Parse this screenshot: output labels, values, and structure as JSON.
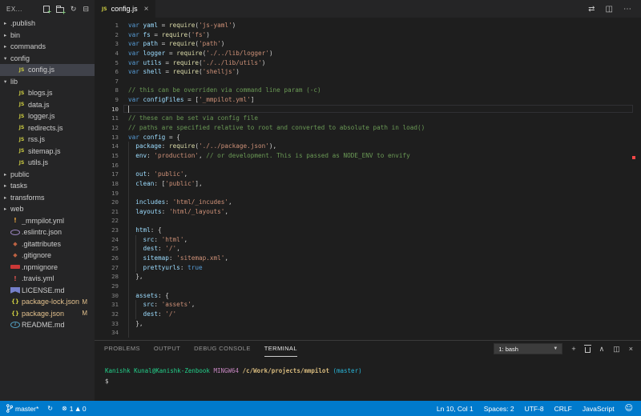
{
  "explorer": {
    "title": "EX...",
    "items": [
      {
        "label": ".publish",
        "kind": "folder",
        "depth": 0
      },
      {
        "label": "bin",
        "kind": "folder",
        "depth": 0
      },
      {
        "label": "commands",
        "kind": "folder",
        "depth": 0
      },
      {
        "label": "config",
        "kind": "folder-open",
        "depth": 0
      },
      {
        "label": "config.js",
        "kind": "js",
        "depth": 1,
        "selected": true
      },
      {
        "label": "lib",
        "kind": "folder-open",
        "depth": 0
      },
      {
        "label": "blogs.js",
        "kind": "js",
        "depth": 1
      },
      {
        "label": "data.js",
        "kind": "js",
        "depth": 1
      },
      {
        "label": "logger.js",
        "kind": "js",
        "depth": 1
      },
      {
        "label": "redirects.js",
        "kind": "js",
        "depth": 1
      },
      {
        "label": "rss.js",
        "kind": "js",
        "depth": 1
      },
      {
        "label": "sitemap.js",
        "kind": "js",
        "depth": 1
      },
      {
        "label": "utils.js",
        "kind": "js",
        "depth": 1
      },
      {
        "label": "public",
        "kind": "folder",
        "depth": 0
      },
      {
        "label": "tasks",
        "kind": "folder",
        "depth": 0
      },
      {
        "label": "transforms",
        "kind": "folder",
        "depth": 0
      },
      {
        "label": "web",
        "kind": "folder",
        "depth": 0
      },
      {
        "label": "_mmpilot.yml",
        "kind": "yml",
        "depth": 0
      },
      {
        "label": ".eslintrc.json",
        "kind": "eslint",
        "depth": 0
      },
      {
        "label": ".gitattributes",
        "kind": "git",
        "depth": 0
      },
      {
        "label": ".gitignore",
        "kind": "git",
        "depth": 0
      },
      {
        "label": ".npmignore",
        "kind": "npm",
        "depth": 0
      },
      {
        "label": ".travis.yml",
        "kind": "yml2",
        "depth": 0
      },
      {
        "label": "LICENSE.md",
        "kind": "license",
        "depth": 0
      },
      {
        "label": "package-lock.json",
        "kind": "json",
        "depth": 0,
        "badge": "M",
        "modified": true
      },
      {
        "label": "package.json",
        "kind": "json",
        "depth": 0,
        "badge": "M",
        "modified": true
      },
      {
        "label": "README.md",
        "kind": "info",
        "depth": 0
      }
    ]
  },
  "tabs": {
    "active_label": "config.js",
    "file_icon": "JS"
  },
  "editor": {
    "cursor_line": 10,
    "lines": [
      {
        "n": 1,
        "g": 0,
        "segs": [
          [
            "k",
            "var"
          ],
          [
            "p",
            " "
          ],
          [
            "v",
            "yaml"
          ],
          [
            "p",
            " = "
          ],
          [
            "f",
            "require"
          ],
          [
            "p",
            "("
          ],
          [
            "s",
            "'js-yaml'"
          ],
          [
            "p",
            ")"
          ]
        ]
      },
      {
        "n": 2,
        "g": 0,
        "segs": [
          [
            "k",
            "var"
          ],
          [
            "p",
            " "
          ],
          [
            "v",
            "fs"
          ],
          [
            "p",
            " = "
          ],
          [
            "f",
            "require"
          ],
          [
            "p",
            "("
          ],
          [
            "s",
            "'fs'"
          ],
          [
            "p",
            ")"
          ]
        ]
      },
      {
        "n": 3,
        "g": 0,
        "segs": [
          [
            "k",
            "var"
          ],
          [
            "p",
            " "
          ],
          [
            "v",
            "path"
          ],
          [
            "p",
            " = "
          ],
          [
            "f",
            "require"
          ],
          [
            "p",
            "("
          ],
          [
            "s",
            "'path'"
          ],
          [
            "p",
            ")"
          ]
        ]
      },
      {
        "n": 4,
        "g": 0,
        "segs": [
          [
            "k",
            "var"
          ],
          [
            "p",
            " "
          ],
          [
            "v",
            "logger"
          ],
          [
            "p",
            " = "
          ],
          [
            "f",
            "require"
          ],
          [
            "p",
            "("
          ],
          [
            "s",
            "'./../lib/logger'"
          ],
          [
            "p",
            ")"
          ]
        ]
      },
      {
        "n": 5,
        "g": 0,
        "segs": [
          [
            "k",
            "var"
          ],
          [
            "p",
            " "
          ],
          [
            "v",
            "utils"
          ],
          [
            "p",
            " = "
          ],
          [
            "f",
            "require"
          ],
          [
            "p",
            "("
          ],
          [
            "s",
            "'./../lib/utils'"
          ],
          [
            "p",
            ")"
          ]
        ]
      },
      {
        "n": 6,
        "g": 0,
        "segs": [
          [
            "k",
            "var"
          ],
          [
            "p",
            " "
          ],
          [
            "v",
            "shell"
          ],
          [
            "p",
            " = "
          ],
          [
            "f",
            "require"
          ],
          [
            "p",
            "("
          ],
          [
            "s",
            "'shelljs'"
          ],
          [
            "p",
            ")"
          ]
        ]
      },
      {
        "n": 7,
        "g": 0,
        "segs": []
      },
      {
        "n": 8,
        "g": 0,
        "segs": [
          [
            "c",
            "// this can be overriden via command line param (-c)"
          ]
        ]
      },
      {
        "n": 9,
        "g": 0,
        "segs": [
          [
            "k",
            "var"
          ],
          [
            "p",
            " "
          ],
          [
            "v",
            "configFiles"
          ],
          [
            "p",
            " = ["
          ],
          [
            "s",
            "'_mmpilot.yml'"
          ],
          [
            "p",
            "]"
          ]
        ]
      },
      {
        "n": 10,
        "g": 0,
        "segs": []
      },
      {
        "n": 11,
        "g": 0,
        "segs": [
          [
            "c",
            "// these can be set via config file"
          ]
        ]
      },
      {
        "n": 12,
        "g": 0,
        "segs": [
          [
            "c",
            "// paths are specified relative to root and converted to absolute path in load()"
          ]
        ]
      },
      {
        "n": 13,
        "g": 0,
        "segs": [
          [
            "k",
            "var"
          ],
          [
            "p",
            " "
          ],
          [
            "v",
            "config"
          ],
          [
            "p",
            " = {"
          ]
        ]
      },
      {
        "n": 14,
        "g": 1,
        "segs": [
          [
            "p",
            "  "
          ],
          [
            "v",
            "package"
          ],
          [
            "p",
            ": "
          ],
          [
            "f",
            "require"
          ],
          [
            "p",
            "("
          ],
          [
            "s",
            "'./../package.json'"
          ],
          [
            "p",
            "),"
          ]
        ]
      },
      {
        "n": 15,
        "g": 1,
        "segs": [
          [
            "p",
            "  "
          ],
          [
            "v",
            "env"
          ],
          [
            "p",
            ": "
          ],
          [
            "s",
            "'production'"
          ],
          [
            "p",
            ", "
          ],
          [
            "c",
            "// or development. This is passed as NODE_ENV to envify"
          ]
        ]
      },
      {
        "n": 16,
        "g": 1,
        "segs": []
      },
      {
        "n": 17,
        "g": 1,
        "segs": [
          [
            "p",
            "  "
          ],
          [
            "v",
            "out"
          ],
          [
            "p",
            ": "
          ],
          [
            "s",
            "'public'"
          ],
          [
            "p",
            ","
          ]
        ]
      },
      {
        "n": 18,
        "g": 1,
        "segs": [
          [
            "p",
            "  "
          ],
          [
            "v",
            "clean"
          ],
          [
            "p",
            ": ["
          ],
          [
            "s",
            "'public'"
          ],
          [
            "p",
            "],"
          ]
        ]
      },
      {
        "n": 19,
        "g": 1,
        "segs": []
      },
      {
        "n": 20,
        "g": 1,
        "segs": [
          [
            "p",
            "  "
          ],
          [
            "v",
            "includes"
          ],
          [
            "p",
            ": "
          ],
          [
            "s",
            "'html/_incudes'"
          ],
          [
            "p",
            ","
          ]
        ]
      },
      {
        "n": 21,
        "g": 1,
        "segs": [
          [
            "p",
            "  "
          ],
          [
            "v",
            "layouts"
          ],
          [
            "p",
            ": "
          ],
          [
            "s",
            "'html/_layouts'"
          ],
          [
            "p",
            ","
          ]
        ]
      },
      {
        "n": 22,
        "g": 1,
        "segs": []
      },
      {
        "n": 23,
        "g": 1,
        "segs": [
          [
            "p",
            "  "
          ],
          [
            "v",
            "html"
          ],
          [
            "p",
            ": {"
          ]
        ]
      },
      {
        "n": 24,
        "g": 2,
        "segs": [
          [
            "p",
            "    "
          ],
          [
            "v",
            "src"
          ],
          [
            "p",
            ": "
          ],
          [
            "s",
            "'html'"
          ],
          [
            "p",
            ","
          ]
        ]
      },
      {
        "n": 25,
        "g": 2,
        "segs": [
          [
            "p",
            "    "
          ],
          [
            "v",
            "dest"
          ],
          [
            "p",
            ": "
          ],
          [
            "s",
            "'/'"
          ],
          [
            "p",
            ","
          ]
        ]
      },
      {
        "n": 26,
        "g": 2,
        "segs": [
          [
            "p",
            "    "
          ],
          [
            "v",
            "sitemap"
          ],
          [
            "p",
            ": "
          ],
          [
            "s",
            "'sitemap.xml'"
          ],
          [
            "p",
            ","
          ]
        ]
      },
      {
        "n": 27,
        "g": 2,
        "segs": [
          [
            "p",
            "    "
          ],
          [
            "v",
            "prettyurls"
          ],
          [
            "p",
            ": "
          ],
          [
            "k",
            "true"
          ]
        ]
      },
      {
        "n": 28,
        "g": 1,
        "segs": [
          [
            "p",
            "  },"
          ]
        ]
      },
      {
        "n": 29,
        "g": 1,
        "segs": []
      },
      {
        "n": 30,
        "g": 1,
        "segs": [
          [
            "p",
            "  "
          ],
          [
            "v",
            "assets"
          ],
          [
            "p",
            ": {"
          ]
        ]
      },
      {
        "n": 31,
        "g": 2,
        "segs": [
          [
            "p",
            "    "
          ],
          [
            "v",
            "src"
          ],
          [
            "p",
            ": "
          ],
          [
            "s",
            "'assets'"
          ],
          [
            "p",
            ","
          ]
        ]
      },
      {
        "n": 32,
        "g": 2,
        "segs": [
          [
            "p",
            "    "
          ],
          [
            "v",
            "dest"
          ],
          [
            "p",
            ": "
          ],
          [
            "s",
            "'/'"
          ]
        ]
      },
      {
        "n": 33,
        "g": 1,
        "segs": [
          [
            "p",
            "  },"
          ]
        ]
      },
      {
        "n": 34,
        "g": 1,
        "segs": []
      }
    ]
  },
  "panel": {
    "tabs": [
      "PROBLEMS",
      "OUTPUT",
      "DEBUG CONSOLE",
      "TERMINAL"
    ],
    "active_tab": "TERMINAL",
    "shell_label": "1: bash",
    "terminal": {
      "user": "Kanishk Kunal@Kanishk-Zenbook",
      "env": "MINGW64",
      "path": "/c/Work/projects/mmpilot",
      "branch": "(master)",
      "prompt": "$"
    }
  },
  "statusbar": {
    "branch": "master*",
    "errors": "1",
    "warnings": "0",
    "ln_col": "Ln 10, Col 1",
    "spaces": "Spaces: 2",
    "encoding": "UTF-8",
    "eol": "CRLF",
    "language": "JavaScript"
  },
  "icons": {
    "refresh": "↻",
    "collapse_all": "⊟",
    "chevron_collapsed": "▸",
    "chevron_expanded": "▾",
    "close": "×",
    "open_changes": "⇄",
    "split_editor": "◫",
    "more": "⋯",
    "dropdown_arrow": "▼",
    "new_terminal": "+",
    "maximize_panel": "∧",
    "split_terminal": "◫",
    "error": "⊗",
    "warning": "▲",
    "sync": "↻",
    "feedback": "☺",
    "git_diamond": "◆",
    "yaml_bang": "!",
    "json_braces": "{}",
    "js_badge": "JS",
    "info_i": "i"
  },
  "colors": {
    "statusbar_bg": "#007acc",
    "accent_modified": "#e2c08d",
    "error_marker": "#f44747",
    "keyword": "#569cd6",
    "string": "#ce9178",
    "comment": "#6a9955"
  }
}
